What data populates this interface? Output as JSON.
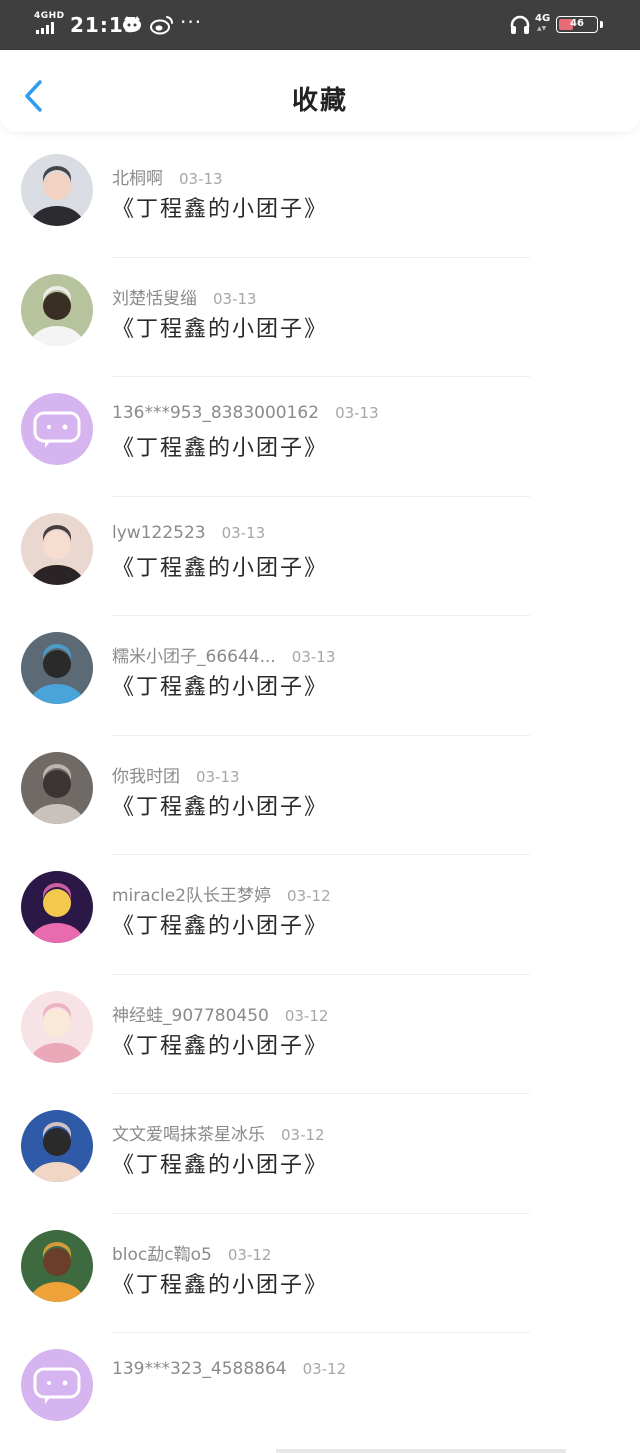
{
  "status_bar": {
    "network": "4GHD",
    "time": "21:15",
    "dots": "···",
    "network2": "4G",
    "battery": "46",
    "battery_level_percent": 46
  },
  "header": {
    "back_icon": "chevron-left-icon",
    "title": "收藏"
  },
  "colors": {
    "accent": "#2f9cf0",
    "status_bar_bg": "#3f3f3f",
    "title_text": "#222222",
    "meta_text": "#9a9a9a",
    "battery_fill": "#e86c78"
  },
  "favorites": [
    {
      "name": "北桐啊",
      "date": "03-13",
      "title": "《丁程鑫的小团子》"
    },
    {
      "name": "刘楚恬叟缁",
      "date": "03-13",
      "title": "《丁程鑫的小团子》"
    },
    {
      "name": "136***953_8383000162",
      "date": "03-13",
      "title": "《丁程鑫的小团子》"
    },
    {
      "name": "lyw122523",
      "date": "03-13",
      "title": "《丁程鑫的小团子》"
    },
    {
      "name": "糯米小团子_66644...",
      "date": "03-13",
      "title": "《丁程鑫的小团子》"
    },
    {
      "name": "你我时团",
      "date": "03-13",
      "title": "《丁程鑫的小团子》"
    },
    {
      "name": "miracle2队长王梦婷",
      "date": "03-12",
      "title": "《丁程鑫的小团子》"
    },
    {
      "name": "神经蛙_907780450",
      "date": "03-12",
      "title": "《丁程鑫的小团子》"
    },
    {
      "name": "文文爱喝抹茶星冰乐",
      "date": "03-12",
      "title": "《丁程鑫的小团子》"
    },
    {
      "name": "bloc勐c鞫o5",
      "date": "03-12",
      "title": "《丁程鑫的小团子》"
    },
    {
      "name": "139***323_4588864",
      "date": "03-12",
      "title": ""
    }
  ]
}
